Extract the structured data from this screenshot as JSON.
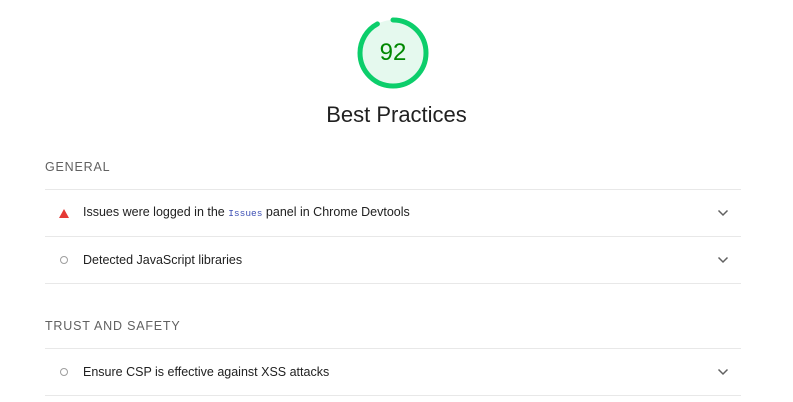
{
  "score": {
    "value": "92",
    "fraction": 0.92,
    "color": "#0cce6b",
    "text_color": "#008800",
    "bg_color": "#e5f9ee"
  },
  "category": {
    "title": "Best Practices"
  },
  "sections": [
    {
      "header": "GENERAL",
      "audits": [
        {
          "icon": "fail-triangle-icon",
          "title_before": "Issues were logged in the ",
          "code": "Issues",
          "title_after": " panel in Chrome Devtools",
          "expand_icon": "chevron-down-icon"
        },
        {
          "icon": "info-circle-icon",
          "title": "Detected JavaScript libraries",
          "expand_icon": "chevron-down-icon"
        }
      ]
    },
    {
      "header": "TRUST AND SAFETY",
      "audits": [
        {
          "icon": "info-circle-icon",
          "title": "Ensure CSP is effective against XSS attacks",
          "expand_icon": "chevron-down-icon"
        }
      ]
    }
  ]
}
